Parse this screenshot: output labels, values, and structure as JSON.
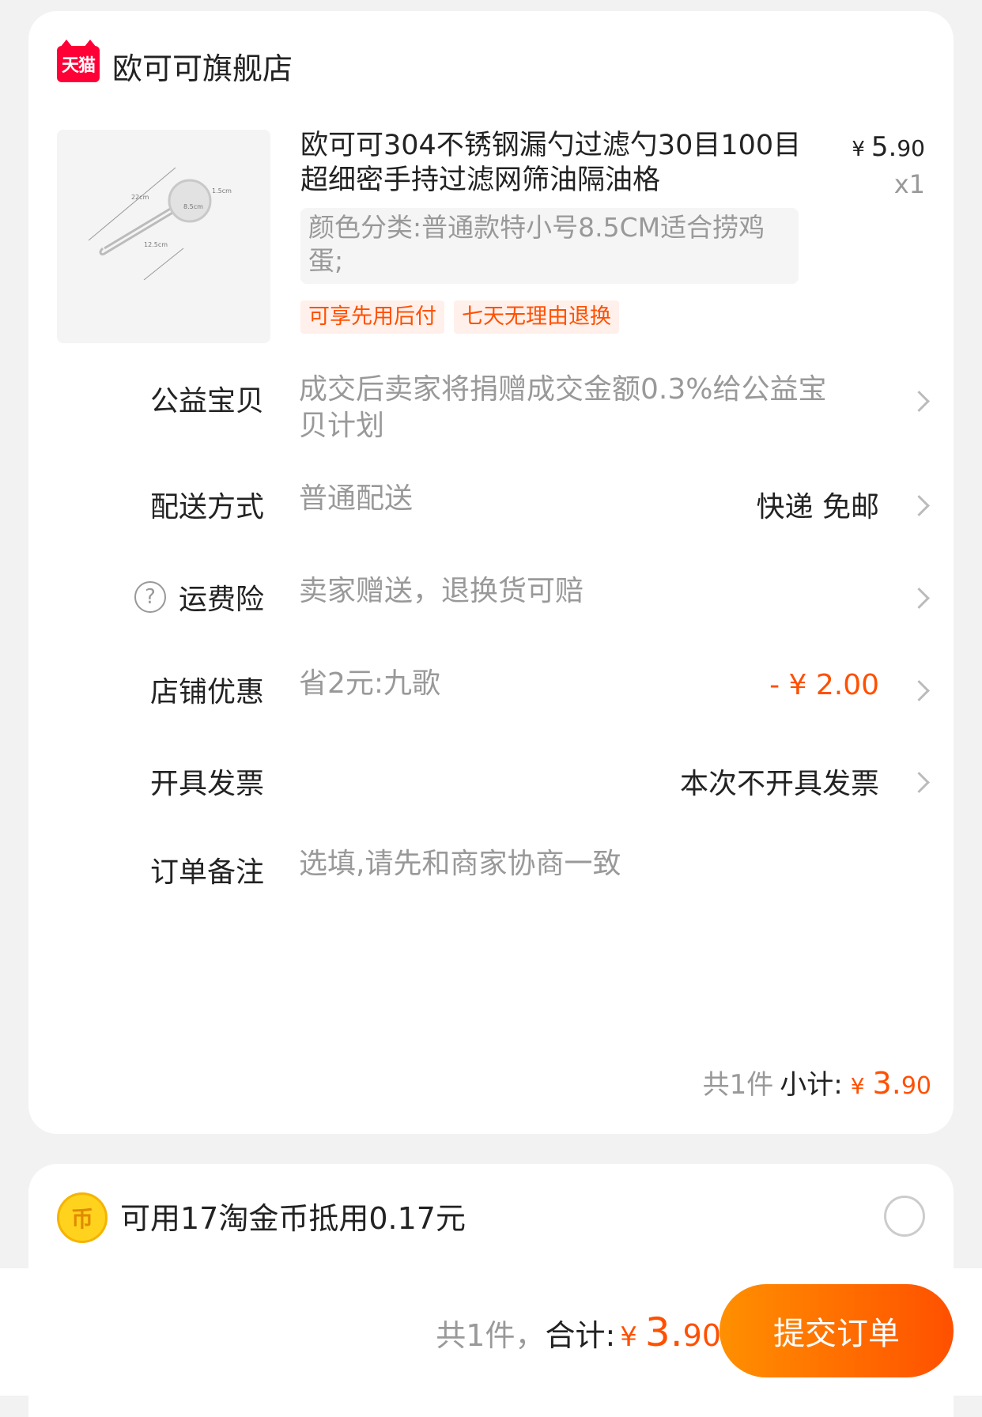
{
  "shop": {
    "badge": "天猫",
    "name": "欧可可旗舰店"
  },
  "product": {
    "title": "欧可可304不锈钢漏勺过滤勺30目100目超细密手持过滤网筛油隔油格",
    "price_currency": "¥",
    "price_main": "5.",
    "price_cents": "90",
    "quantity": "x1",
    "sku": "颜色分类:普通款特小号8.5CM适合捞鸡蛋;",
    "tags": [
      "可享先用后付",
      "七天无理由退换"
    ],
    "thumb_labels": {
      "length": "22cm",
      "depth": "1.5cm",
      "diameter": "8.5cm",
      "handle": "12.5cm"
    }
  },
  "rows": {
    "charity": {
      "label": "公益宝贝",
      "value": "成交后卖家将捐赠成交金额0.3%给公益宝贝计划"
    },
    "shipping": {
      "label": "配送方式",
      "value": "普通配送",
      "right": "快递 免邮"
    },
    "insurance": {
      "label": "运费险",
      "value": "卖家赠送，退换货可赔"
    },
    "discount": {
      "label": "店铺优惠",
      "value": "省2元:九歌",
      "right": "- ¥ 2.00"
    },
    "invoice": {
      "label": "开具发票",
      "right": "本次不开具发票"
    },
    "remark": {
      "label": "订单备注",
      "placeholder": "选填,请先和商家协商一致"
    }
  },
  "subtotal": {
    "count": "共1件",
    "label": "小计:",
    "currency": "¥",
    "main": "3.",
    "cents": "90"
  },
  "coins": {
    "icon_glyph": "币",
    "text": "可用17淘金币抵用0.17元"
  },
  "footer": {
    "count": "共1件，",
    "label": "合计:",
    "currency": "¥",
    "main": "3.",
    "cents": "90",
    "submit": "提交订单"
  },
  "colors": {
    "accent": "#ff5000",
    "tmall": "#ff0036",
    "coin": "#ffd21e"
  },
  "icons": [
    "tmall-icon",
    "question-icon",
    "chevron-right-icon",
    "coin-icon",
    "radio-icon"
  ]
}
